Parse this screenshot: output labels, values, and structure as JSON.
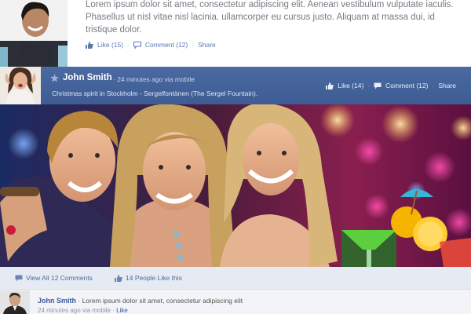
{
  "top_post": {
    "text": "Lorem ipsum dolor sit amet, consectetur adipiscing elit. Aenean vestibulum vulputate iaculis. Phasellus ut nisl vitae nisl lacinia. ullamcorper eu cursus justo. Aliquam at massa dui, id tristique dolor.",
    "like_label": "Like (15)",
    "comment_label": "Comment (12)",
    "share_label": "Share",
    "separator": "·"
  },
  "post": {
    "author": "John Smith",
    "meta": "· 24 minutes ago via mobile",
    "caption": "Christmas spirit in Stockholm - Sergelfontänen (The Sergel Fountain).",
    "like_label": "Like (14)",
    "comment_label": "Comment (12)",
    "share_label": "Share",
    "separator": "·"
  },
  "stats": {
    "view_comments": "View All 12 Comments",
    "likes": "14 People Like this"
  },
  "comment": {
    "author": "John Smith",
    "body": "· Lorem ipsum dolor sit amet, consectetur adipiscing elit",
    "meta": "24 minutes ago via mobile ·",
    "like_label": "Like"
  },
  "icons": {
    "like": "thumbs-up-icon",
    "comment": "speech-bubble-icon",
    "star": "star-icon"
  },
  "colors": {
    "header_bar": "#3e5c93",
    "link": "#5b79ad",
    "stats_bar": "#e6ebf3"
  }
}
